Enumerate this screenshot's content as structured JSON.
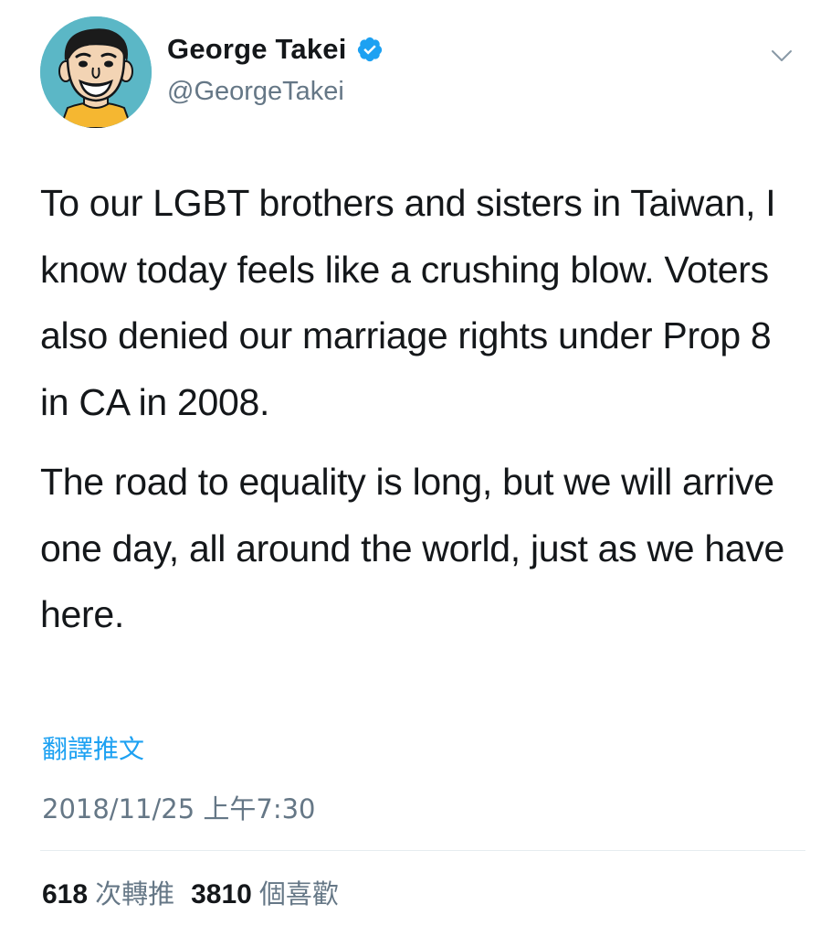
{
  "author": {
    "display_name": "George Takei",
    "handle": "@GeorgeTakei",
    "verified_icon": "verified-badge-icon",
    "avatar_icon": "cartoon-avatar"
  },
  "menu": {
    "icon": "chevron-down-icon"
  },
  "tweet": {
    "paragraphs": [
      "To our LGBT brothers and sisters in Taiwan, I know today feels like a crushing blow. Voters also denied our marriage rights under Prop 8 in CA in 2008.",
      "The road to equality is long, but we will arrive one day, all around the world, just as we have here."
    ],
    "translate_label": "翻譯推文",
    "timestamp": "2018/11/25 上午7:30"
  },
  "stats": {
    "retweets_count": "618",
    "retweets_label": "次轉推",
    "likes_count": "3810",
    "likes_label": "個喜歡"
  },
  "colors": {
    "accent": "#1da1f2",
    "secondary_text": "#657786",
    "primary_text": "#14171a",
    "divider": "#e6ecf0"
  }
}
